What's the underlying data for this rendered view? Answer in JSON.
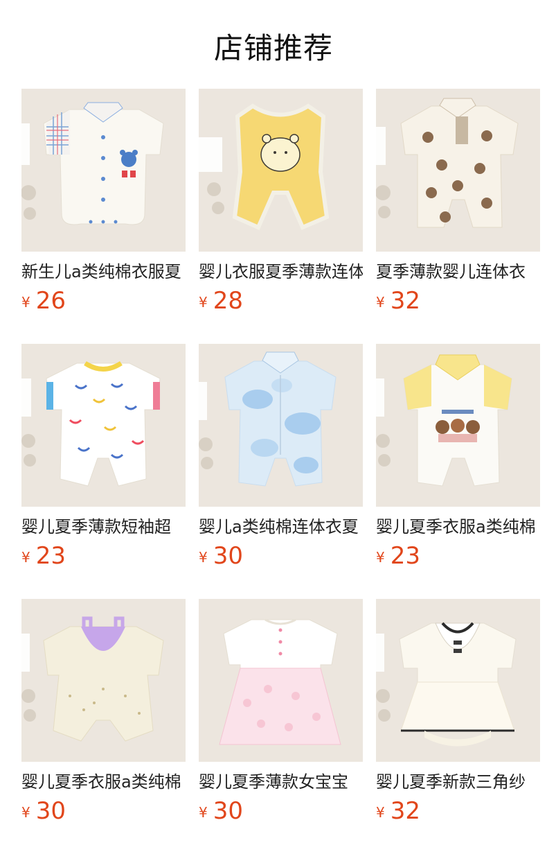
{
  "header": {
    "title": "店铺推荐"
  },
  "colors": {
    "price": "#e1461b",
    "title": "#111111",
    "photo_bg": "#ece6de"
  },
  "products": [
    {
      "name": "新生儿a类纯棉衣服夏",
      "currency": "¥",
      "price": "26",
      "image": "white-romper-plaid-collar"
    },
    {
      "name": "婴儿衣服夏季薄款连体",
      "currency": "¥",
      "price": "28",
      "image": "yellow-sleeveless-romper-pooh"
    },
    {
      "name": "夏季薄款婴儿连体衣",
      "currency": "¥",
      "price": "32",
      "image": "bear-print-romper"
    },
    {
      "name": "婴儿夏季薄款短袖超",
      "currency": "¥",
      "price": "23",
      "image": "smiley-face-romper"
    },
    {
      "name": "婴儿a类纯棉连体衣夏",
      "currency": "¥",
      "price": "30",
      "image": "blue-tie-dye-romper"
    },
    {
      "name": "婴儿夏季衣服a类纯棉",
      "currency": "¥",
      "price": "23",
      "image": "yellow-collar-bear-romper"
    },
    {
      "name": "婴儿夏季衣服a类纯棉",
      "currency": "¥",
      "price": "30",
      "image": "floral-purple-bib-romper"
    },
    {
      "name": "婴儿夏季薄款女宝宝",
      "currency": "¥",
      "price": "30",
      "image": "pink-tulle-dress-romper"
    },
    {
      "name": "婴儿夏季新款三角纱",
      "currency": "¥",
      "price": "32",
      "image": "white-lace-collar-dress-romper"
    }
  ]
}
